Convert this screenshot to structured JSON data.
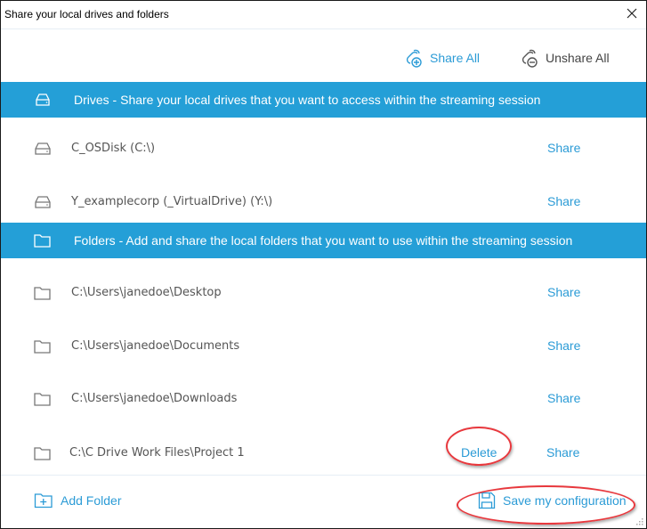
{
  "window": {
    "title": "Share your local drives and folders",
    "close_icon": "close-icon"
  },
  "toolbar": {
    "share_all_label": "Share All",
    "unshare_all_label": "Unshare All"
  },
  "drives_section": {
    "label": "Drives - Share your local drives that you want to access within the streaming session",
    "icon": "drive-icon",
    "items": [
      {
        "path": "C_OSDisk (C:\\)",
        "share_label": "Share"
      },
      {
        "path": "Y_examplecorp (_VirtualDrive) (Y:\\)",
        "share_label": "Share"
      }
    ]
  },
  "folders_section": {
    "label": "Folders - Add and share the local folders that you want to use within the streaming session",
    "icon": "folder-icon",
    "items": [
      {
        "path": "C:\\Users\\janedoe\\Desktop",
        "share_label": "Share"
      },
      {
        "path": "C:\\Users\\janedoe\\Documents",
        "share_label": "Share"
      },
      {
        "path": "C:\\Users\\janedoe\\Downloads",
        "share_label": "Share"
      },
      {
        "path": "C:\\C Drive Work Files\\Project 1",
        "delete_label": "Delete",
        "share_label": "Share"
      }
    ]
  },
  "footer": {
    "add_folder_label": "Add Folder",
    "save_config_label": "Save my configuration"
  },
  "colors": {
    "accent": "#2b9bd6",
    "section_bar": "#249fd7",
    "annotation": "#e8383d"
  }
}
